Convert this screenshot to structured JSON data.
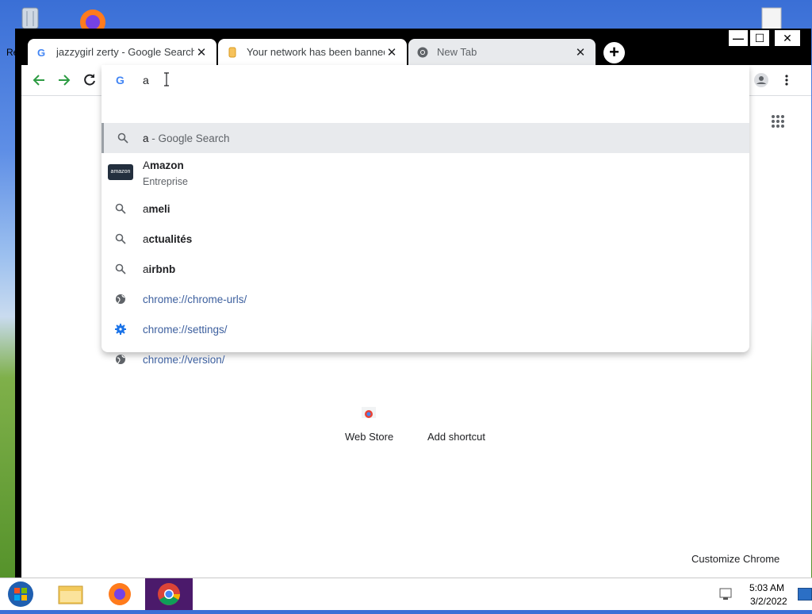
{
  "desktop": {
    "left_label": "Re"
  },
  "tabs": [
    {
      "title": "jazzygirl zerty - Google Search",
      "icon": "google-g-icon",
      "close": "✕"
    },
    {
      "title": "Your network has been banned f",
      "icon": "page-icon",
      "close": "✕"
    },
    {
      "title": "New Tab",
      "icon": "chrome-icon",
      "close": "✕"
    }
  ],
  "window_controls": {
    "minimize": "—",
    "maximize": "☐",
    "close": "✕"
  },
  "omnibox": {
    "input_value": "a",
    "suggestions": [
      {
        "type": "search",
        "prefix": "a",
        "bold": "",
        "suffix": " - Google Search",
        "icon": "search-icon"
      },
      {
        "type": "entity",
        "prefix": "A",
        "bold": "mazon",
        "subtitle": "Entreprise",
        "icon": "amazon-logo"
      },
      {
        "type": "search",
        "prefix": "a",
        "bold": "meli",
        "icon": "search-icon"
      },
      {
        "type": "search",
        "prefix": "a",
        "bold": "ctualités",
        "icon": "search-icon"
      },
      {
        "type": "search",
        "prefix": "a",
        "bold": "irbnb",
        "icon": "search-icon"
      },
      {
        "type": "url",
        "text": "chrome://chrome-urls/",
        "icon": "globe-icon"
      },
      {
        "type": "url",
        "text": "chrome://settings/",
        "icon": "gear-icon"
      },
      {
        "type": "url",
        "text": "chrome://version/",
        "icon": "globe-icon"
      }
    ],
    "amazon_logo_text": "amazon"
  },
  "ntp": {
    "shortcuts": [
      {
        "label": "Web Store"
      },
      {
        "label": "Add shortcut"
      }
    ],
    "customize": "Customize Chrome"
  },
  "taskbar": {
    "time": "5:03 AM",
    "date": "3/2/2022"
  },
  "colors": {
    "chrome_accent": "#1a73e8",
    "nav_green": "#2e9c44",
    "taskbar_active": "#4b1a6b"
  }
}
